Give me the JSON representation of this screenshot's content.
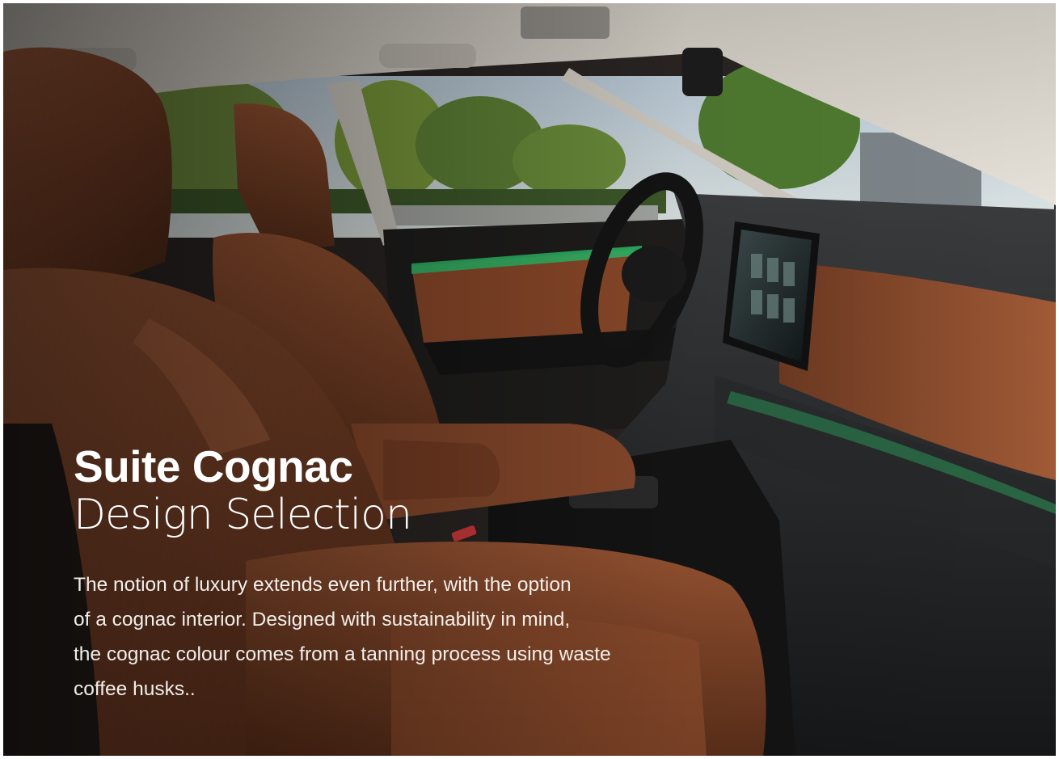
{
  "heading": {
    "title": "Suite Cognac",
    "subtitle": "Design Selection"
  },
  "description": {
    "lines": [
      "The notion of luxury extends even further, with the option",
      "of a cognac interior. Designed with sustainability in mind,",
      "the cognac colour comes from a tanning process using waste",
      "coffee husks.."
    ]
  },
  "colors": {
    "cognac_leather": "#8a4a2c",
    "ambient_light": "#2fbf6a",
    "dashboard_dark": "#2a2c2e",
    "headliner": "#d8d4cc"
  }
}
